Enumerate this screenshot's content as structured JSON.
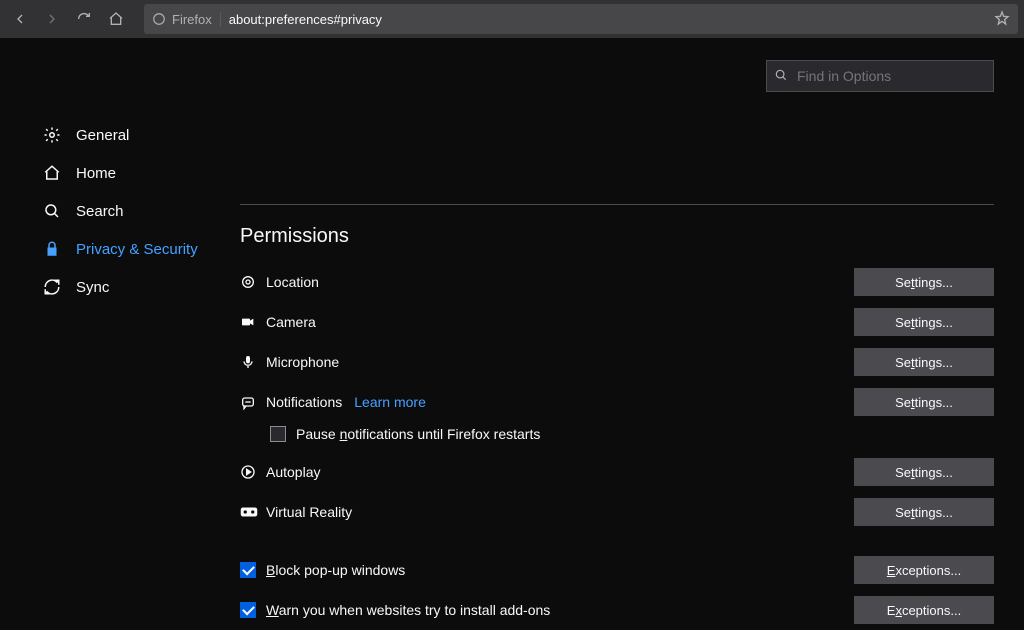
{
  "toolbar": {
    "firefox_label": "Firefox",
    "url": "about:preferences#privacy"
  },
  "search": {
    "placeholder": "Find in Options"
  },
  "sidebar": {
    "items": [
      {
        "label": "General"
      },
      {
        "label": "Home"
      },
      {
        "label": "Search"
      },
      {
        "label": "Privacy & Security"
      },
      {
        "label": "Sync"
      }
    ]
  },
  "section": {
    "title": "Permissions"
  },
  "permissions": {
    "location": {
      "label": "Location",
      "button": "Settings..."
    },
    "camera": {
      "label": "Camera",
      "button": "Settings..."
    },
    "microphone": {
      "label": "Microphone",
      "button": "Settings..."
    },
    "notifications": {
      "label": "Notifications",
      "learn": "Learn more",
      "button": "Settings...",
      "pause_label": "Pause notifications until Firefox restarts"
    },
    "autoplay": {
      "label": "Autoplay",
      "button": "Settings..."
    },
    "vr": {
      "label": "Virtual Reality",
      "button": "Settings..."
    }
  },
  "checks": {
    "popup": {
      "label": "Block pop-up windows",
      "button": "Exceptions..."
    },
    "addons": {
      "label": "Warn you when websites try to install add-ons",
      "button": "Exceptions..."
    }
  }
}
